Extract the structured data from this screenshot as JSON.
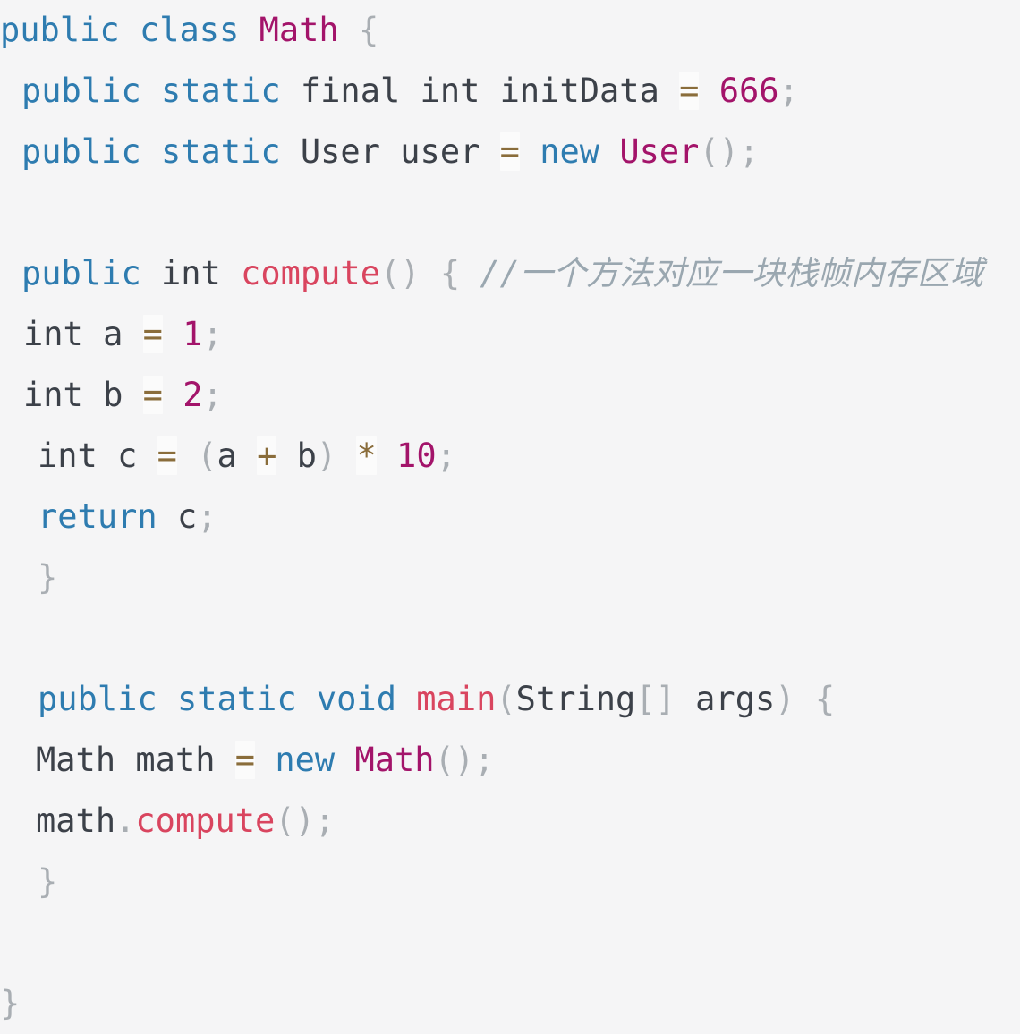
{
  "editor": {
    "language": "java",
    "background_color": "#f5f5f6",
    "theme": "light",
    "colors": {
      "keyword": "#2e7cb0",
      "class_name": "#a3146a",
      "method_name": "#d9455f",
      "number": "#a3146a",
      "operator": "#8a6d3b",
      "operator_highlight_bg": "#fbfbfb",
      "punctuation": "#a9aeb3",
      "identifier": "#3c4149",
      "comment": "#9aa7b0"
    }
  },
  "code": {
    "lines": [
      {
        "n": 1,
        "indent": "ind0",
        "text": "public class Math {",
        "tokens": [
          {
            "t": "public",
            "c": "kw"
          },
          {
            "t": " ",
            "c": "id"
          },
          {
            "t": "class",
            "c": "kw"
          },
          {
            "t": " ",
            "c": "id"
          },
          {
            "t": "Math",
            "c": "cls"
          },
          {
            "t": " ",
            "c": "id"
          },
          {
            "t": "{",
            "c": "punc"
          }
        ]
      },
      {
        "n": 2,
        "indent": "ind1",
        "text": "public static final int initData = 666;",
        "tokens": [
          {
            "t": "public",
            "c": "kw"
          },
          {
            "t": " ",
            "c": "id"
          },
          {
            "t": "static",
            "c": "kw"
          },
          {
            "t": " ",
            "c": "id"
          },
          {
            "t": "final",
            "c": "type"
          },
          {
            "t": " ",
            "c": "id"
          },
          {
            "t": "int",
            "c": "type"
          },
          {
            "t": " ",
            "c": "id"
          },
          {
            "t": "initData",
            "c": "id"
          },
          {
            "t": " ",
            "c": "id"
          },
          {
            "t": "=",
            "c": "op"
          },
          {
            "t": " ",
            "c": "id"
          },
          {
            "t": "666",
            "c": "num"
          },
          {
            "t": ";",
            "c": "punc"
          }
        ]
      },
      {
        "n": 3,
        "indent": "ind1",
        "text": "public static User user = new User();",
        "tokens": [
          {
            "t": "public",
            "c": "kw"
          },
          {
            "t": " ",
            "c": "id"
          },
          {
            "t": "static",
            "c": "kw"
          },
          {
            "t": " ",
            "c": "id"
          },
          {
            "t": "User",
            "c": "type"
          },
          {
            "t": " ",
            "c": "id"
          },
          {
            "t": "user",
            "c": "id"
          },
          {
            "t": " ",
            "c": "id"
          },
          {
            "t": "=",
            "c": "op"
          },
          {
            "t": " ",
            "c": "id"
          },
          {
            "t": "new",
            "c": "kw"
          },
          {
            "t": " ",
            "c": "id"
          },
          {
            "t": "User",
            "c": "cls"
          },
          {
            "t": "();",
            "c": "punc"
          }
        ]
      },
      {
        "n": 4,
        "indent": "ind0",
        "text": "",
        "tokens": []
      },
      {
        "n": 5,
        "indent": "ind1",
        "text": "public int compute() { //一个方法对应一块栈帧内存区域",
        "tokens": [
          {
            "t": "public",
            "c": "kw"
          },
          {
            "t": " ",
            "c": "id"
          },
          {
            "t": "int",
            "c": "type"
          },
          {
            "t": " ",
            "c": "id"
          },
          {
            "t": "compute",
            "c": "fn"
          },
          {
            "t": "()",
            "c": "punc"
          },
          {
            "t": " ",
            "c": "id"
          },
          {
            "t": "{",
            "c": "punc"
          },
          {
            "t": " ",
            "c": "id"
          },
          {
            "t": "//一个方法对应一块栈帧内存区域",
            "c": "cmt"
          }
        ]
      },
      {
        "n": 6,
        "indent": "ind2",
        "text": "int a = 1;",
        "tokens": [
          {
            "t": "int",
            "c": "type"
          },
          {
            "t": " ",
            "c": "id"
          },
          {
            "t": "a",
            "c": "id"
          },
          {
            "t": " ",
            "c": "id"
          },
          {
            "t": "=",
            "c": "op"
          },
          {
            "t": " ",
            "c": "id"
          },
          {
            "t": "1",
            "c": "num"
          },
          {
            "t": ";",
            "c": "punc"
          }
        ]
      },
      {
        "n": 7,
        "indent": "ind2",
        "text": "int b = 2;",
        "tokens": [
          {
            "t": "int",
            "c": "type"
          },
          {
            "t": " ",
            "c": "id"
          },
          {
            "t": "b",
            "c": "id"
          },
          {
            "t": " ",
            "c": "id"
          },
          {
            "t": "=",
            "c": "op"
          },
          {
            "t": " ",
            "c": "id"
          },
          {
            "t": "2",
            "c": "num"
          },
          {
            "t": ";",
            "c": "punc"
          }
        ]
      },
      {
        "n": 8,
        "indent": "ind4",
        "text": "int c = (a + b) * 10;",
        "tokens": [
          {
            "t": "int",
            "c": "type"
          },
          {
            "t": " ",
            "c": "id"
          },
          {
            "t": "c",
            "c": "id"
          },
          {
            "t": " ",
            "c": "id"
          },
          {
            "t": "=",
            "c": "op"
          },
          {
            "t": " ",
            "c": "id"
          },
          {
            "t": "(",
            "c": "punc"
          },
          {
            "t": "a",
            "c": "id"
          },
          {
            "t": " ",
            "c": "id"
          },
          {
            "t": "+",
            "c": "op"
          },
          {
            "t": " ",
            "c": "id"
          },
          {
            "t": "b",
            "c": "id"
          },
          {
            "t": ")",
            "c": "punc"
          },
          {
            "t": " ",
            "c": "id"
          },
          {
            "t": "*",
            "c": "op"
          },
          {
            "t": " ",
            "c": "id"
          },
          {
            "t": "10",
            "c": "num"
          },
          {
            "t": ";",
            "c": "punc"
          }
        ]
      },
      {
        "n": 9,
        "indent": "ind4",
        "text": "return c;",
        "tokens": [
          {
            "t": "return",
            "c": "kw"
          },
          {
            "t": " ",
            "c": "id"
          },
          {
            "t": "c",
            "c": "id"
          },
          {
            "t": ";",
            "c": "punc"
          }
        ]
      },
      {
        "n": 10,
        "indent": "ind4",
        "text": "}",
        "tokens": [
          {
            "t": "}",
            "c": "punc"
          }
        ]
      },
      {
        "n": 11,
        "indent": "ind0",
        "text": "",
        "tokens": []
      },
      {
        "n": 12,
        "indent": "ind4",
        "text": "public static void main(String[] args) {",
        "tokens": [
          {
            "t": "public",
            "c": "kw"
          },
          {
            "t": " ",
            "c": "id"
          },
          {
            "t": "static",
            "c": "kw"
          },
          {
            "t": " ",
            "c": "id"
          },
          {
            "t": "void",
            "c": "kw"
          },
          {
            "t": " ",
            "c": "id"
          },
          {
            "t": "main",
            "c": "fn"
          },
          {
            "t": "(",
            "c": "punc"
          },
          {
            "t": "String",
            "c": "type"
          },
          {
            "t": "[]",
            "c": "punc"
          },
          {
            "t": " ",
            "c": "id"
          },
          {
            "t": "args",
            "c": "id"
          },
          {
            "t": ")",
            "c": "punc"
          },
          {
            "t": " ",
            "c": "id"
          },
          {
            "t": "{",
            "c": "punc"
          }
        ]
      },
      {
        "n": 13,
        "indent": "ind3",
        "text": "Math math = new Math();",
        "tokens": [
          {
            "t": "Math",
            "c": "type"
          },
          {
            "t": " ",
            "c": "id"
          },
          {
            "t": "math",
            "c": "id"
          },
          {
            "t": " ",
            "c": "id"
          },
          {
            "t": "=",
            "c": "op"
          },
          {
            "t": " ",
            "c": "id"
          },
          {
            "t": "new",
            "c": "kw"
          },
          {
            "t": " ",
            "c": "id"
          },
          {
            "t": "Math",
            "c": "cls"
          },
          {
            "t": "();",
            "c": "punc"
          }
        ]
      },
      {
        "n": 14,
        "indent": "ind3",
        "text": "math.compute();",
        "tokens": [
          {
            "t": "math",
            "c": "id"
          },
          {
            "t": ".",
            "c": "punc"
          },
          {
            "t": "compute",
            "c": "fn"
          },
          {
            "t": "();",
            "c": "punc"
          }
        ]
      },
      {
        "n": 15,
        "indent": "ind4",
        "text": "}",
        "tokens": [
          {
            "t": "}",
            "c": "punc"
          }
        ]
      },
      {
        "n": 16,
        "indent": "ind0",
        "text": "",
        "tokens": []
      },
      {
        "n": 17,
        "indent": "ind0",
        "text": "}",
        "tokens": [
          {
            "t": "}",
            "c": "punc"
          }
        ]
      }
    ]
  }
}
